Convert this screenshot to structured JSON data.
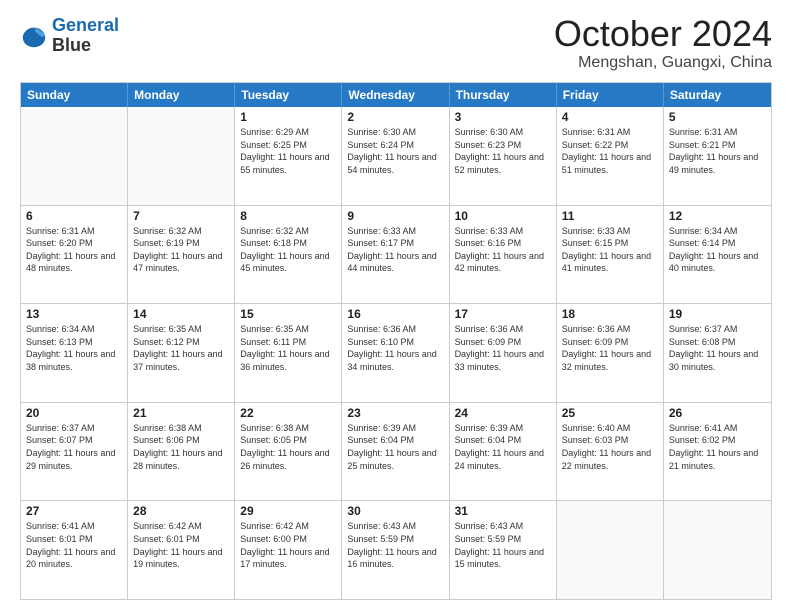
{
  "logo": {
    "line1": "General",
    "line2": "Blue"
  },
  "title": "October 2024",
  "location": "Mengshan, Guangxi, China",
  "headers": [
    "Sunday",
    "Monday",
    "Tuesday",
    "Wednesday",
    "Thursday",
    "Friday",
    "Saturday"
  ],
  "weeks": [
    [
      {
        "day": "",
        "text": ""
      },
      {
        "day": "",
        "text": ""
      },
      {
        "day": "1",
        "text": "Sunrise: 6:29 AM\nSunset: 6:25 PM\nDaylight: 11 hours and 55 minutes."
      },
      {
        "day": "2",
        "text": "Sunrise: 6:30 AM\nSunset: 6:24 PM\nDaylight: 11 hours and 54 minutes."
      },
      {
        "day": "3",
        "text": "Sunrise: 6:30 AM\nSunset: 6:23 PM\nDaylight: 11 hours and 52 minutes."
      },
      {
        "day": "4",
        "text": "Sunrise: 6:31 AM\nSunset: 6:22 PM\nDaylight: 11 hours and 51 minutes."
      },
      {
        "day": "5",
        "text": "Sunrise: 6:31 AM\nSunset: 6:21 PM\nDaylight: 11 hours and 49 minutes."
      }
    ],
    [
      {
        "day": "6",
        "text": "Sunrise: 6:31 AM\nSunset: 6:20 PM\nDaylight: 11 hours and 48 minutes."
      },
      {
        "day": "7",
        "text": "Sunrise: 6:32 AM\nSunset: 6:19 PM\nDaylight: 11 hours and 47 minutes."
      },
      {
        "day": "8",
        "text": "Sunrise: 6:32 AM\nSunset: 6:18 PM\nDaylight: 11 hours and 45 minutes."
      },
      {
        "day": "9",
        "text": "Sunrise: 6:33 AM\nSunset: 6:17 PM\nDaylight: 11 hours and 44 minutes."
      },
      {
        "day": "10",
        "text": "Sunrise: 6:33 AM\nSunset: 6:16 PM\nDaylight: 11 hours and 42 minutes."
      },
      {
        "day": "11",
        "text": "Sunrise: 6:33 AM\nSunset: 6:15 PM\nDaylight: 11 hours and 41 minutes."
      },
      {
        "day": "12",
        "text": "Sunrise: 6:34 AM\nSunset: 6:14 PM\nDaylight: 11 hours and 40 minutes."
      }
    ],
    [
      {
        "day": "13",
        "text": "Sunrise: 6:34 AM\nSunset: 6:13 PM\nDaylight: 11 hours and 38 minutes."
      },
      {
        "day": "14",
        "text": "Sunrise: 6:35 AM\nSunset: 6:12 PM\nDaylight: 11 hours and 37 minutes."
      },
      {
        "day": "15",
        "text": "Sunrise: 6:35 AM\nSunset: 6:11 PM\nDaylight: 11 hours and 36 minutes."
      },
      {
        "day": "16",
        "text": "Sunrise: 6:36 AM\nSunset: 6:10 PM\nDaylight: 11 hours and 34 minutes."
      },
      {
        "day": "17",
        "text": "Sunrise: 6:36 AM\nSunset: 6:09 PM\nDaylight: 11 hours and 33 minutes."
      },
      {
        "day": "18",
        "text": "Sunrise: 6:36 AM\nSunset: 6:09 PM\nDaylight: 11 hours and 32 minutes."
      },
      {
        "day": "19",
        "text": "Sunrise: 6:37 AM\nSunset: 6:08 PM\nDaylight: 11 hours and 30 minutes."
      }
    ],
    [
      {
        "day": "20",
        "text": "Sunrise: 6:37 AM\nSunset: 6:07 PM\nDaylight: 11 hours and 29 minutes."
      },
      {
        "day": "21",
        "text": "Sunrise: 6:38 AM\nSunset: 6:06 PM\nDaylight: 11 hours and 28 minutes."
      },
      {
        "day": "22",
        "text": "Sunrise: 6:38 AM\nSunset: 6:05 PM\nDaylight: 11 hours and 26 minutes."
      },
      {
        "day": "23",
        "text": "Sunrise: 6:39 AM\nSunset: 6:04 PM\nDaylight: 11 hours and 25 minutes."
      },
      {
        "day": "24",
        "text": "Sunrise: 6:39 AM\nSunset: 6:04 PM\nDaylight: 11 hours and 24 minutes."
      },
      {
        "day": "25",
        "text": "Sunrise: 6:40 AM\nSunset: 6:03 PM\nDaylight: 11 hours and 22 minutes."
      },
      {
        "day": "26",
        "text": "Sunrise: 6:41 AM\nSunset: 6:02 PM\nDaylight: 11 hours and 21 minutes."
      }
    ],
    [
      {
        "day": "27",
        "text": "Sunrise: 6:41 AM\nSunset: 6:01 PM\nDaylight: 11 hours and 20 minutes."
      },
      {
        "day": "28",
        "text": "Sunrise: 6:42 AM\nSunset: 6:01 PM\nDaylight: 11 hours and 19 minutes."
      },
      {
        "day": "29",
        "text": "Sunrise: 6:42 AM\nSunset: 6:00 PM\nDaylight: 11 hours and 17 minutes."
      },
      {
        "day": "30",
        "text": "Sunrise: 6:43 AM\nSunset: 5:59 PM\nDaylight: 11 hours and 16 minutes."
      },
      {
        "day": "31",
        "text": "Sunrise: 6:43 AM\nSunset: 5:59 PM\nDaylight: 11 hours and 15 minutes."
      },
      {
        "day": "",
        "text": ""
      },
      {
        "day": "",
        "text": ""
      }
    ]
  ]
}
